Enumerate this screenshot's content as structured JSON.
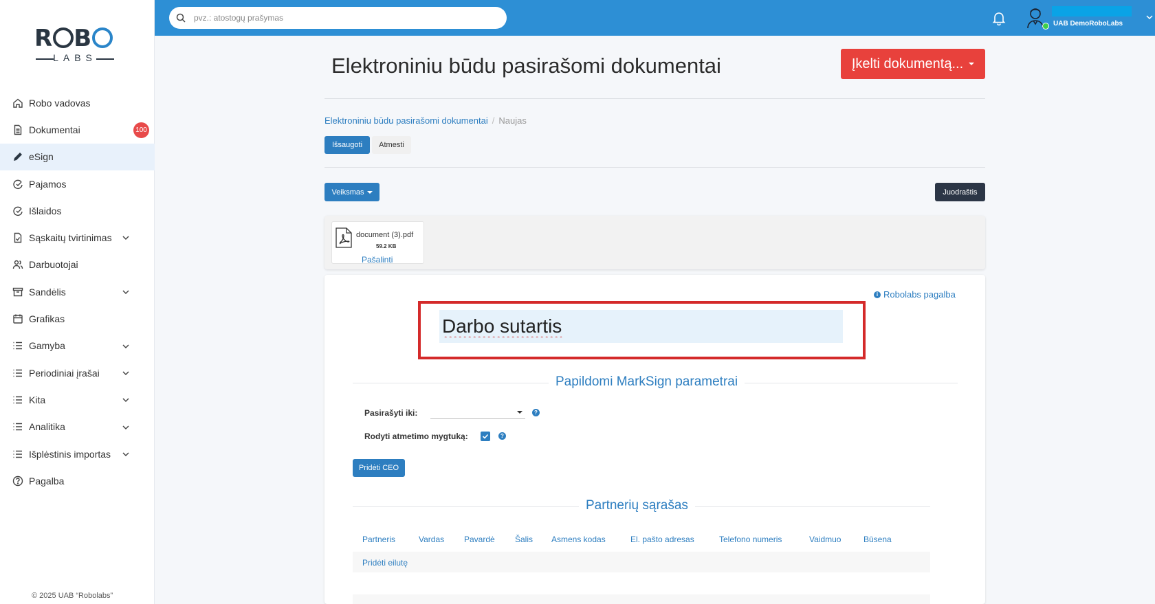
{
  "app": {
    "logo_top": "ROBO",
    "logo_bottom": "LABS",
    "copyright": "© 2025 UAB “Robolabs”"
  },
  "sidebar": {
    "items": [
      {
        "label": "Robo vadovas",
        "icon": "home-icon"
      },
      {
        "label": "Dokumentai",
        "icon": "document-icon",
        "badge": "100"
      },
      {
        "label": "eSign",
        "icon": "pen-icon"
      },
      {
        "label": "Pajamos",
        "icon": "income-icon"
      },
      {
        "label": "Išlaidos",
        "icon": "expense-icon"
      },
      {
        "label": "Sąskaitų tvirtinimas",
        "icon": "file-check-icon"
      },
      {
        "label": "Darbuotojai",
        "icon": "users-icon"
      },
      {
        "label": "Sandėlis",
        "icon": "archive-icon"
      },
      {
        "label": "Grafikas",
        "icon": "calendar-icon"
      },
      {
        "label": "Gamyba",
        "icon": "list-icon"
      },
      {
        "label": "Periodiniai įrašai",
        "icon": "list-icon"
      },
      {
        "label": "Kita",
        "icon": "list-icon"
      },
      {
        "label": "Analitika",
        "icon": "list-icon"
      },
      {
        "label": "Išplėstinis importas",
        "icon": "list-icon"
      },
      {
        "label": "Pagalba",
        "icon": "help-icon"
      }
    ]
  },
  "topbar": {
    "search_placeholder": "pvz.: atostogų prašymas",
    "company": "UAB DemoRoboLabs"
  },
  "page": {
    "title": "Elektroniniu būdu pasirašomi dokumentai",
    "upload_button": "Įkelti dokumentą...",
    "breadcrumb_parent": "Elektroniniu būdu pasirašomi dokumentai",
    "breadcrumb_current": "Naujas",
    "save_button": "Išsaugoti",
    "discard_button": "Atmesti",
    "action_button": "Veiksmas",
    "status_button": "Juodraštis"
  },
  "attachment": {
    "filename": "document (3).pdf",
    "size": "59.2 KB",
    "remove": "Pašalinti"
  },
  "form": {
    "help_link": "Robolabs pagalba",
    "title_value": "Darbo sutartis",
    "marksign_section": "Papildomi MarkSign parametrai",
    "sign_until_label": "Pasirašyti iki:",
    "show_reject_label": "Rodyti atmetimo mygtuką:",
    "show_reject_checked": true,
    "add_ceo_button": "Pridėti CEO",
    "partners_section": "Partnerių sąrašas",
    "table_headers": [
      "Partneris",
      "Vardas",
      "Pavardė",
      "Šalis",
      "Asmens kodas",
      "El. pašto adresas",
      "Telefono numeris",
      "Vaidmuo",
      "Būsena"
    ],
    "add_row": "Pridėti eilutę"
  },
  "colors": {
    "primary": "#2d7ec0",
    "topbar": "#2d8fd5",
    "danger": "#e8413c",
    "dark": "#2c3646",
    "highlight": "#d42a2a"
  }
}
